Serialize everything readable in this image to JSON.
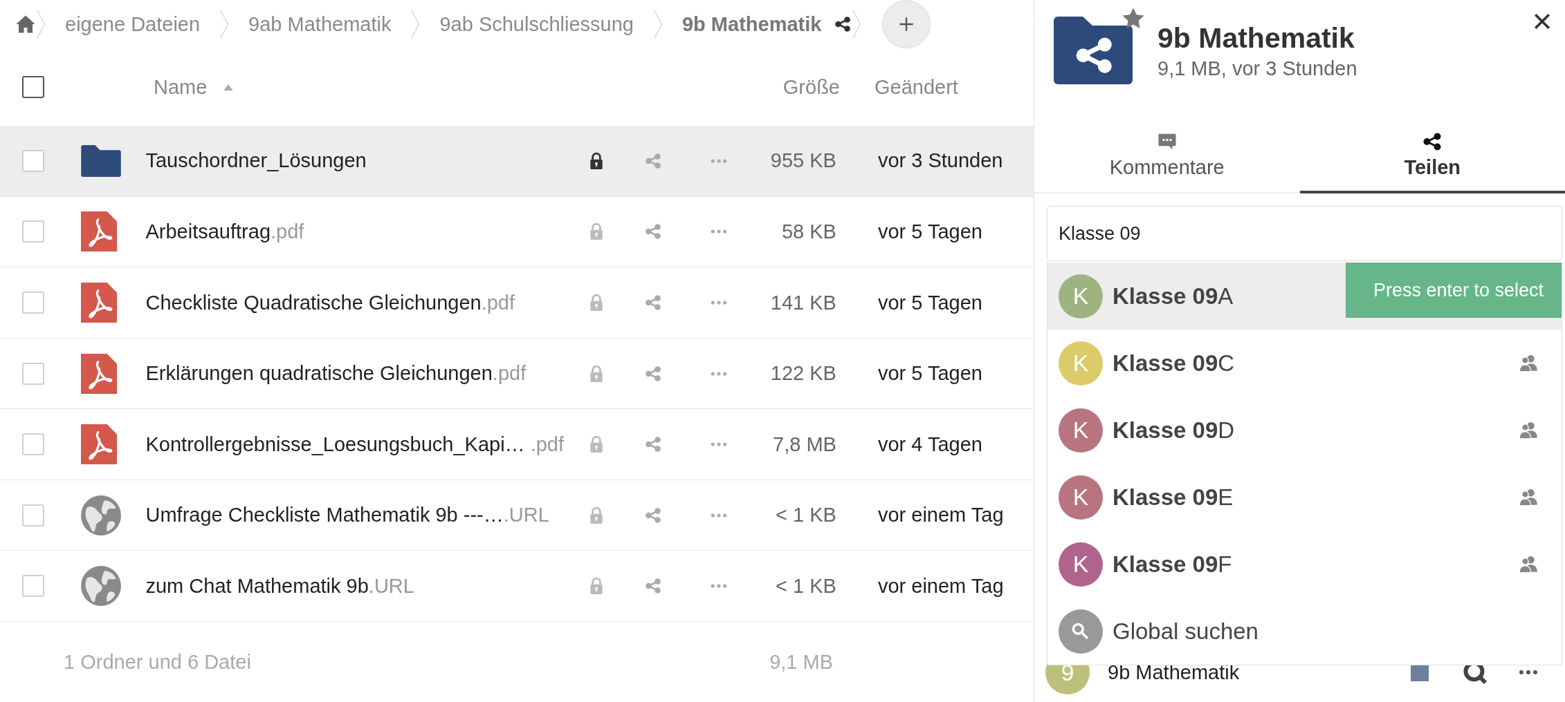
{
  "breadcrumb": {
    "items": [
      {
        "label": "eigene Dateien",
        "current": false
      },
      {
        "label": "9ab Mathematik",
        "current": false
      },
      {
        "label": "9ab Schulschliessung",
        "current": false
      },
      {
        "label": "9b Mathematik",
        "current": true
      }
    ]
  },
  "table": {
    "select_all_checked": false,
    "columns": {
      "name": "Name",
      "size": "Größe",
      "modified": "Geändert"
    },
    "rows": [
      {
        "kind": "folder",
        "name": "Tauschordner_Lösungen",
        "size": "955 KB",
        "modified": "vor 3 Stunden",
        "selected": true
      },
      {
        "kind": "pdf",
        "name": "Arbeitsauftrag",
        "extension": ".pdf",
        "size": "58 KB",
        "modified": "vor 5 Tagen",
        "selected": false
      },
      {
        "kind": "pdf",
        "name": "Checkliste Quadratische Gleichungen",
        "extension": ".pdf",
        "size": "141 KB",
        "modified": "vor 5 Tagen",
        "selected": false
      },
      {
        "kind": "pdf",
        "name": "Erklärungen quadratische Gleichungen",
        "extension": ".pdf",
        "size": "122 KB",
        "modified": "vor 5 Tagen",
        "selected": false
      },
      {
        "kind": "pdf",
        "name": "Kontrollergebnisse_Loesungsbuch_Kapi… ",
        "extension": ".pdf",
        "size": "7,8 MB",
        "modified": "vor 4 Tagen",
        "selected": false
      },
      {
        "kind": "url",
        "name": "Umfrage Checkliste Mathematik 9b ---…",
        "extension": ".URL",
        "size": "< 1 KB",
        "modified": "vor einem Tag",
        "selected": false
      },
      {
        "kind": "url",
        "name": "zum Chat Mathematik 9b",
        "extension": ".URL",
        "size": "< 1 KB",
        "modified": "vor einem Tag",
        "selected": false
      }
    ],
    "footer": {
      "summary": "1 Ordner und 6 Datei",
      "total": "9,1 MB"
    }
  },
  "sidebar": {
    "title": "9b Mathematik",
    "subtitle": "9,1 MB, vor 3 Stunden",
    "starred": true,
    "tabs": [
      {
        "kind": "comments",
        "label": "Kommentare",
        "selected": false
      },
      {
        "kind": "share",
        "label": "Teilen",
        "selected": true
      }
    ],
    "share_search": {
      "value": "Klasse 09"
    },
    "suggestions": [
      {
        "kind": "group",
        "initial": "K",
        "label": "**Klasse 09**A",
        "color": "#9db480",
        "selected": true,
        "hint": "Press enter to select"
      },
      {
        "kind": "group",
        "initial": "K",
        "label": "**Klasse 09**C",
        "color": "#dccb6a",
        "selected": false
      },
      {
        "kind": "group",
        "initial": "K",
        "label": "**Klasse 09**D",
        "color": "#b87580",
        "selected": false
      },
      {
        "kind": "group",
        "initial": "K",
        "label": "**Klasse 09**E",
        "color": "#b87580",
        "selected": false
      },
      {
        "kind": "group",
        "initial": "K",
        "label": "**Klasse 09**F",
        "color": "#b0648c",
        "selected": false
      },
      {
        "kind": "search",
        "label": "Global suchen"
      }
    ],
    "shares": [
      {
        "initial": "9",
        "label": "9b Mathematik",
        "color": "#bcc07a"
      }
    ]
  }
}
